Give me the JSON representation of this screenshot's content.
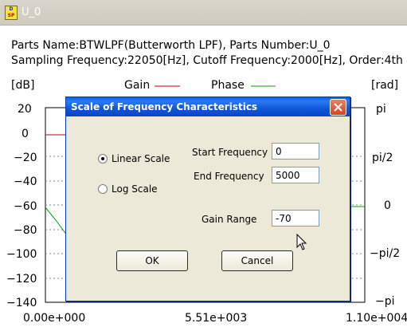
{
  "window": {
    "title": "U_0",
    "icon_text_top": "D",
    "icon_text_bottom": "SP"
  },
  "info": {
    "line1": "Parts Name:BTWLPF(Butterworth LPF), Parts Number:U_0",
    "line2": "Sampling Frequency:22050[Hz], Cutoff Frequency:2000[Hz], Order:4th"
  },
  "axes": {
    "left_unit": "[dB]",
    "right_unit": "[rad]",
    "legend_gain": "Gain",
    "legend_phase": "Phase",
    "left_ticks": [
      "20",
      "0",
      "−20",
      "−40",
      "−60",
      "−80",
      "−100",
      "−120",
      "−140"
    ],
    "right_ticks": [
      "pi",
      "pi/2",
      "0",
      "−pi/2",
      "−pi"
    ],
    "x_ticks": [
      "0.00e+000",
      "5.51e+003",
      "1.10e+004"
    ]
  },
  "colors": {
    "gain": "#c00000",
    "phase": "#00a000"
  },
  "dialog": {
    "title": "Scale of Frequency Characteristics",
    "linear_label": "Linear Scale",
    "log_label": "Log Scale",
    "linear_selected": true,
    "start_label": "Start Frequency",
    "start_value": "0",
    "end_label": "End Frequency",
    "end_value": "5000",
    "gain_label": "Gain Range",
    "gain_value": "-70",
    "ok_label": "OK",
    "cancel_label": "Cancel"
  }
}
